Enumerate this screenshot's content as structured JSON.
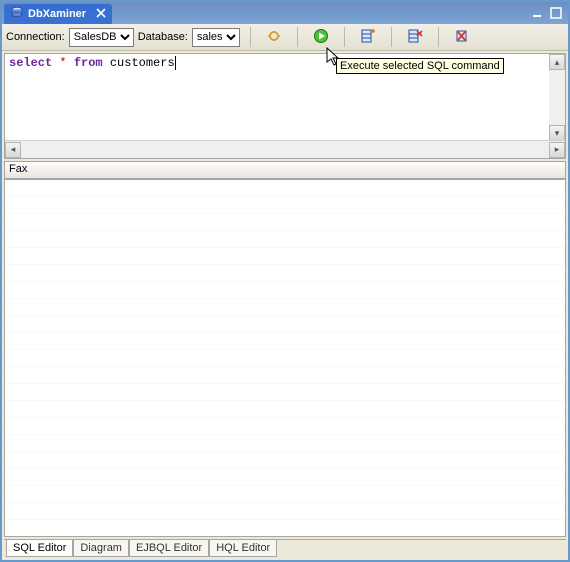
{
  "title": {
    "tab_label": "DbXaminer"
  },
  "toolbar": {
    "connection_label": "Connection:",
    "connection_value": "SalesDB",
    "database_label": "Database:",
    "database_value": "sales"
  },
  "sql": {
    "keyword1": "select",
    "star": " * ",
    "keyword2": "from",
    "ident": " customers"
  },
  "tooltip": {
    "execute": "Execute selected SQL command"
  },
  "results": {
    "header": "Fax"
  },
  "tabs": {
    "items": [
      "SQL Editor",
      "Diagram",
      "EJBQL Editor",
      "HQL Editor"
    ],
    "active_index": 0
  }
}
